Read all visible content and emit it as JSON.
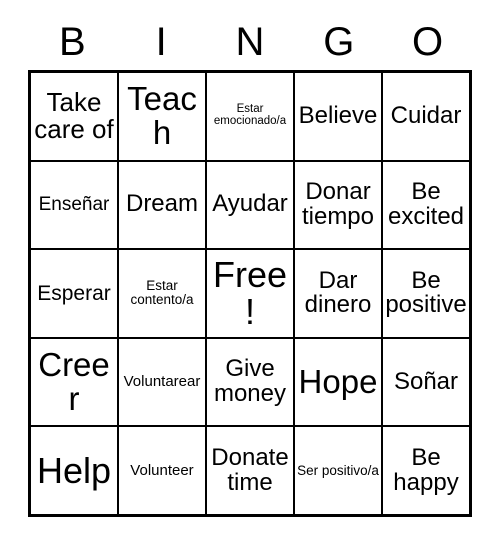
{
  "card": {
    "title": "BINGO",
    "free_space_label": "Free!",
    "text_color": "#000000",
    "background_color": "#ffffff",
    "border_color": "#000000"
  },
  "header": {
    "letters": [
      {
        "label": "B"
      },
      {
        "label": "I"
      },
      {
        "label": "N"
      },
      {
        "label": "G"
      },
      {
        "label": "O"
      }
    ]
  },
  "grid": {
    "columns": 5,
    "rows": 5,
    "cells": [
      [
        {
          "text": "Take care of"
        },
        {
          "text": "Teach"
        },
        {
          "text": "Estar emocionado/a"
        },
        {
          "text": "Believe"
        },
        {
          "text": "Cuidar"
        }
      ],
      [
        {
          "text": "Enseñar"
        },
        {
          "text": "Dream"
        },
        {
          "text": "Ayudar"
        },
        {
          "text": "Donar tiempo"
        },
        {
          "text": "Be excited"
        }
      ],
      [
        {
          "text": "Esperar"
        },
        {
          "text": "Estar contento/a"
        },
        {
          "text": "Free!"
        },
        {
          "text": "Dar dinero"
        },
        {
          "text": "Be positive"
        }
      ],
      [
        {
          "text": "Creer"
        },
        {
          "text": "Voluntarear"
        },
        {
          "text": "Give money"
        },
        {
          "text": "Hope"
        },
        {
          "text": "Soñar"
        }
      ],
      [
        {
          "text": "Help"
        },
        {
          "text": "Volunteer"
        },
        {
          "text": "Donate time"
        },
        {
          "text": "Ser positivo/a"
        },
        {
          "text": "Be happy"
        }
      ]
    ]
  }
}
